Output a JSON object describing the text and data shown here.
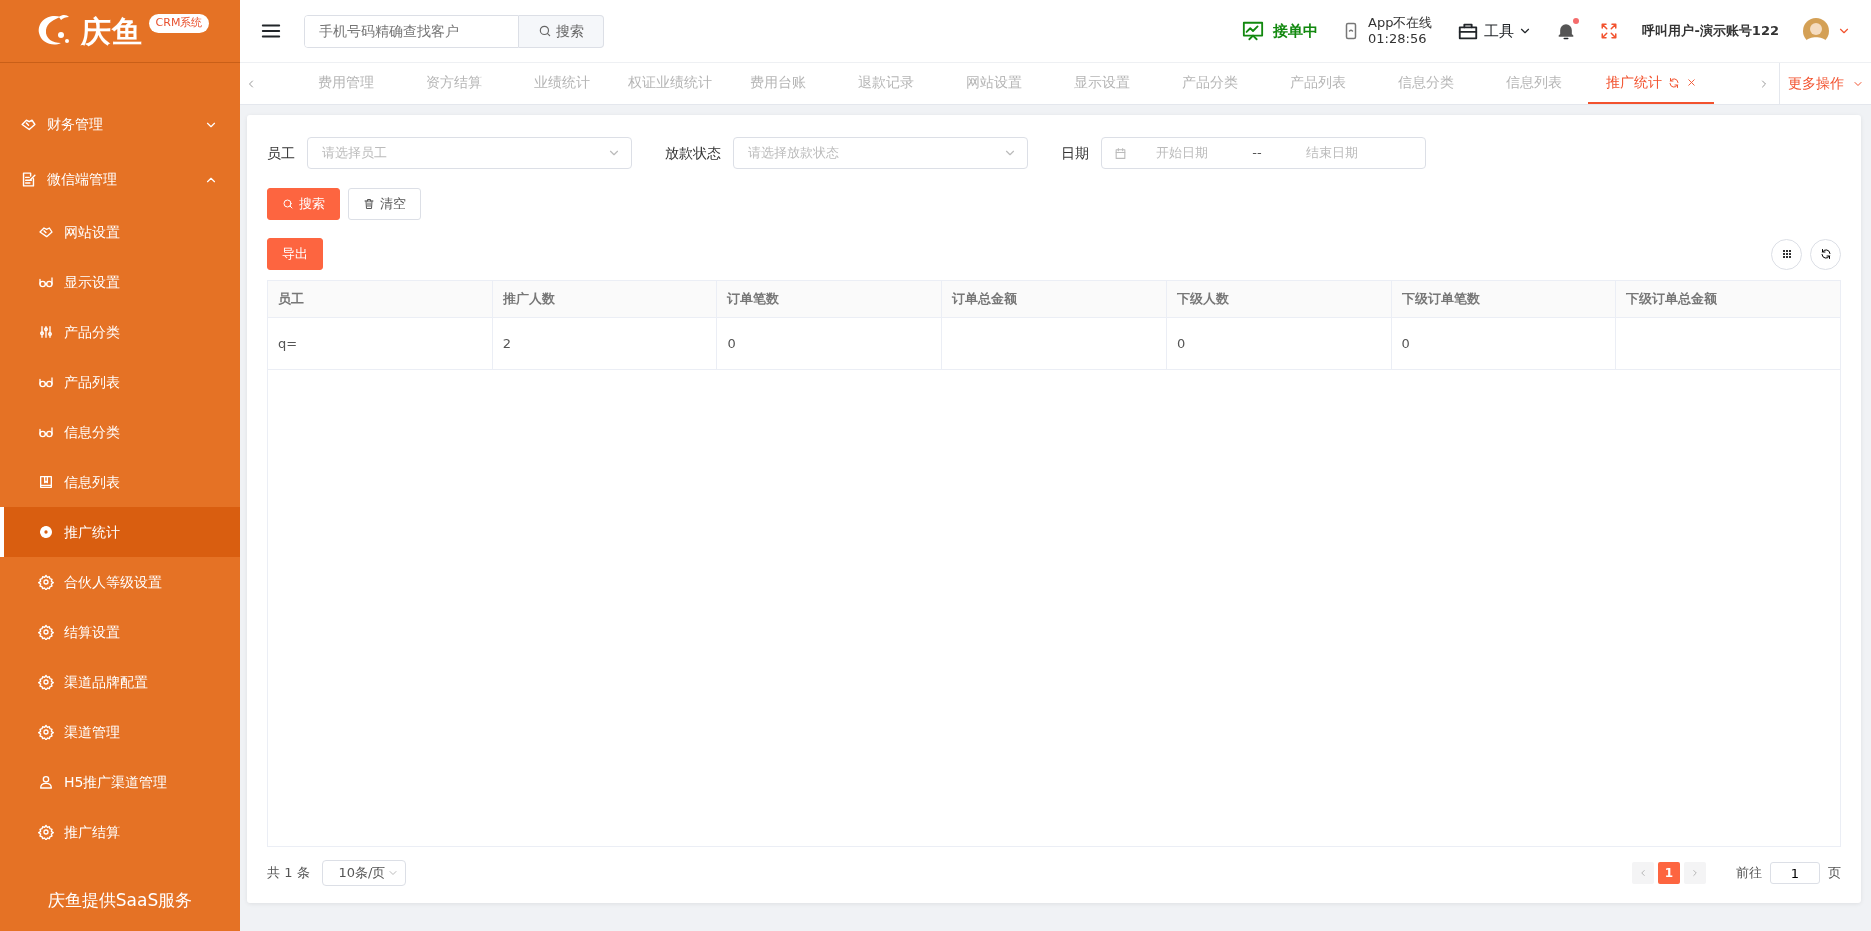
{
  "logo": {
    "text": "庆鱼",
    "badge": "CRM系统"
  },
  "sidebar": {
    "items": [
      {
        "label": "财务管理",
        "expanded": false
      },
      {
        "label": "微信端管理",
        "expanded": true,
        "children": [
          {
            "label": "网站设置",
            "selected": false
          },
          {
            "label": "显示设置",
            "selected": false
          },
          {
            "label": "产品分类",
            "selected": false
          },
          {
            "label": "产品列表",
            "selected": false
          },
          {
            "label": "信息分类",
            "selected": false
          },
          {
            "label": "信息列表",
            "selected": false
          },
          {
            "label": "推广统计",
            "selected": true
          },
          {
            "label": "合伙人等级设置",
            "selected": false
          },
          {
            "label": "结算设置",
            "selected": false
          },
          {
            "label": "渠道品牌配置",
            "selected": false
          },
          {
            "label": "渠道管理",
            "selected": false
          },
          {
            "label": "H5推广渠道管理",
            "selected": false
          },
          {
            "label": "推广结算",
            "selected": false
          }
        ]
      }
    ],
    "footer": "庆鱼提供SaaS服务"
  },
  "header": {
    "search": {
      "placeholder": "手机号码精确查找客户",
      "button": "搜索"
    },
    "order_status": "接单中",
    "app_status": "App不在线",
    "app_time": "01:28:56",
    "tools": "工具",
    "notifications": true,
    "user": "呼叫用户-演示账号122"
  },
  "tabs": [
    {
      "label": "费用管理",
      "selected": false
    },
    {
      "label": "资方结算",
      "selected": false
    },
    {
      "label": "业绩统计",
      "selected": false
    },
    {
      "label": "权证业绩统计",
      "selected": false
    },
    {
      "label": "费用台账",
      "selected": false
    },
    {
      "label": "退款记录",
      "selected": false
    },
    {
      "label": "网站设置",
      "selected": false
    },
    {
      "label": "显示设置",
      "selected": false
    },
    {
      "label": "产品分类",
      "selected": false
    },
    {
      "label": "产品列表",
      "selected": false
    },
    {
      "label": "信息分类",
      "selected": false
    },
    {
      "label": "信息列表",
      "selected": false
    },
    {
      "label": "推广统计",
      "selected": true
    }
  ],
  "more_actions": "更多操作",
  "filters": [
    {
      "kind": "select",
      "label": "员工",
      "placeholder": "请选择员工"
    },
    {
      "kind": "select",
      "label": "放款状态",
      "placeholder": "请选择放款状态"
    },
    {
      "kind": "daterange",
      "label": "日期",
      "start_placeholder": "开始日期",
      "separator": "--",
      "end_placeholder": "结束日期"
    }
  ],
  "buttons": {
    "search": "搜索",
    "clear": "清空",
    "export": "导出"
  },
  "table": {
    "columns": [
      "员工",
      "推广人数",
      "订单笔数",
      "订单总金额",
      "下级人数",
      "下级订单笔数",
      "下级订单总金额"
    ],
    "rows": [
      [
        "q=",
        "2",
        "0",
        null,
        "0",
        "0",
        null
      ]
    ]
  },
  "pagination": {
    "total": "共 1 条",
    "page_size": "10条/页",
    "pages": [
      {
        "label": "1",
        "selected": true
      }
    ],
    "goto_label": "前往",
    "goto_value": "1",
    "goto_suffix": "页"
  }
}
